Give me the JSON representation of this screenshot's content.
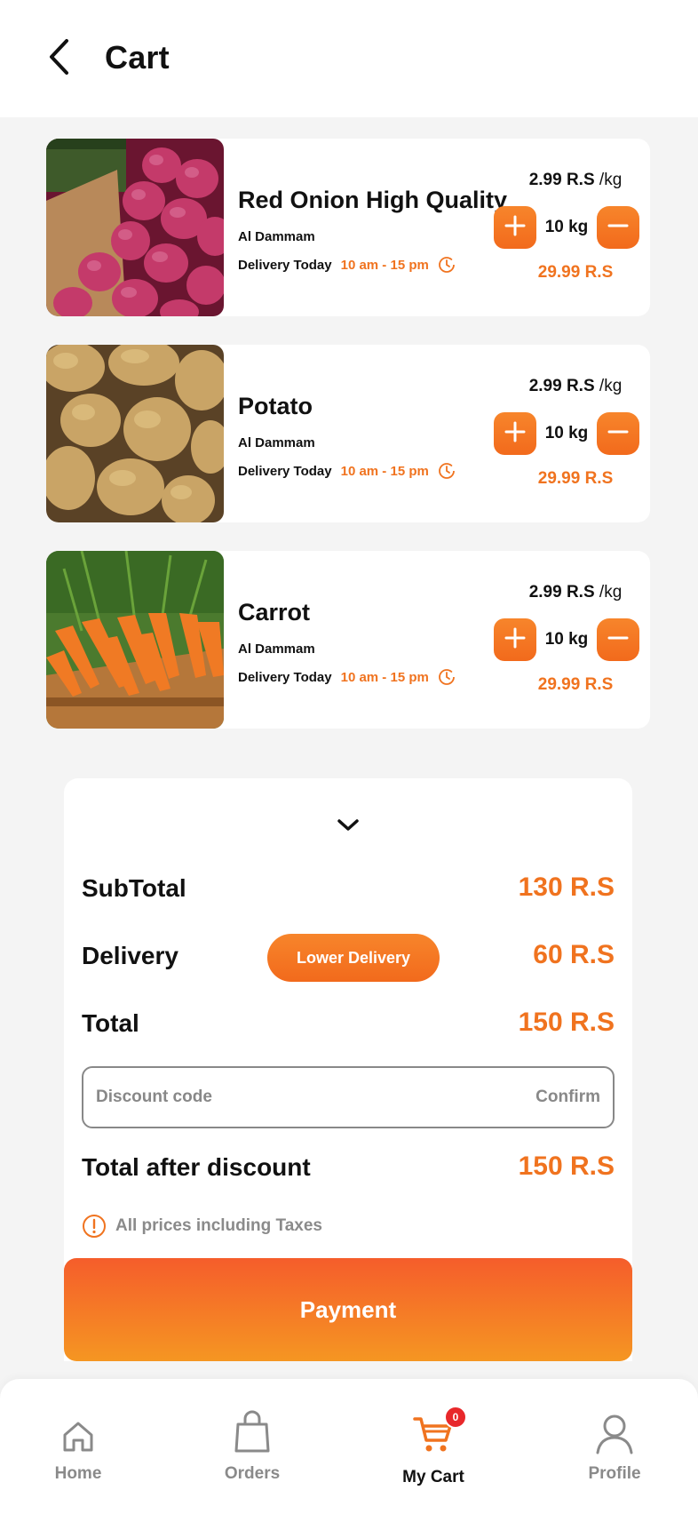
{
  "header": {
    "title": "Cart"
  },
  "items": [
    {
      "name": "Red Onion High Quality",
      "city": "Al Dammam",
      "delivery_label": "Delivery Today",
      "delivery_time": "10 am - 15 pm",
      "unit_price": "2.99 R.S",
      "unit": "/kg",
      "quantity": "10 kg",
      "total": "29.99 R.S",
      "image": "red-onion-photo"
    },
    {
      "name": "Potato",
      "city": "Al Dammam",
      "delivery_label": "Delivery Today",
      "delivery_time": "10 am - 15 pm",
      "unit_price": "2.99 R.S",
      "unit": "/kg",
      "quantity": "10 kg",
      "total": "29.99 R.S",
      "image": "potato-photo"
    },
    {
      "name": "Carrot",
      "city": "Al Dammam",
      "delivery_label": "Delivery Today",
      "delivery_time": "10 am - 15 pm",
      "unit_price": "2.99 R.S",
      "unit": "/kg",
      "quantity": "10 kg",
      "total": "29.99 R.S",
      "image": "carrot-photo"
    }
  ],
  "summary": {
    "subtotal_label": "SubTotal",
    "subtotal_value": "130 R.S",
    "delivery_label": "Delivery",
    "lower_delivery_label": "Lower Delivery",
    "delivery_value": "60 R.S",
    "total_label": "Total",
    "total_value": "150 R.S",
    "discount_placeholder": "Discount code",
    "discount_value": "",
    "confirm_label": "Confirm",
    "after_discount_label": "Total after discount",
    "after_discount_value": "150 R.S",
    "tax_note": "All prices including Taxes"
  },
  "payment_label": "Payment",
  "nav": {
    "items": [
      {
        "label": "Home",
        "icon": "home-icon"
      },
      {
        "label": "Orders",
        "icon": "bag-icon"
      },
      {
        "label": "My Cart",
        "icon": "cart-icon",
        "badge": "0",
        "active": true
      },
      {
        "label": "Profile",
        "icon": "user-icon"
      }
    ]
  },
  "colors": {
    "accent": "#f0731f",
    "accent_gradient_top": "#f55d2b",
    "accent_gradient_bottom": "#f59622",
    "badge": "#e8282b",
    "background": "#f4f4f4"
  }
}
